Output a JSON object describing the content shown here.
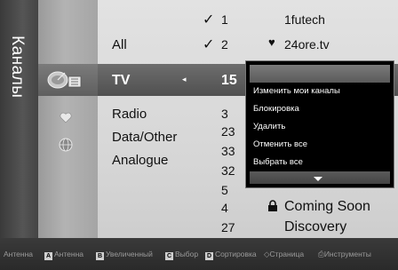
{
  "side": {
    "title": "Каналы"
  },
  "categories": {
    "items": [
      "All",
      "TV",
      "Radio",
      "Data/Other",
      "Analogue"
    ],
    "selected": "TV"
  },
  "channels": {
    "numbers": [
      "1",
      "2",
      "15",
      "3",
      "23",
      "33",
      "32",
      "5",
      "4",
      "27"
    ],
    "names": [
      "1futech",
      "24ore.tv",
      "Coming Soon",
      "Discovery"
    ]
  },
  "popup": {
    "items": [
      "Изменить мои каналы",
      "Блокировка",
      "Удалить",
      "Отменить все",
      "Выбрать все"
    ]
  },
  "bottom_bar": {
    "antenna_label": "Антенна",
    "a_key": "A",
    "a_label": "Антенна",
    "b_key": "B",
    "b_label": "Увеличенный",
    "c_key": "C",
    "c_label": "Выбор",
    "d_key": "D",
    "d_label": "Сортировка",
    "page_label": "Страница",
    "tools_label": "Инструменты"
  }
}
